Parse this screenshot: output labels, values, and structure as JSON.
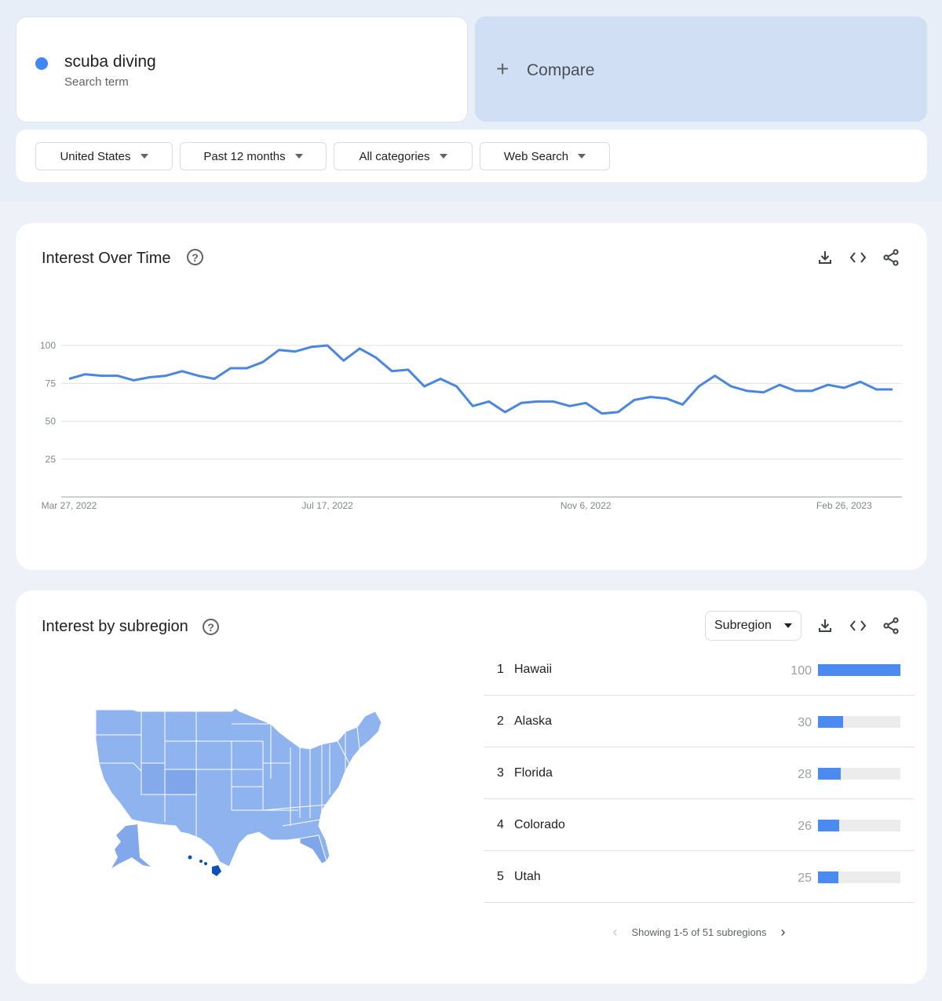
{
  "search_term": {
    "name": "scuba diving",
    "subtitle": "Search term",
    "color": "#4285f4"
  },
  "compare": {
    "icon": "plus-icon",
    "label": "Compare"
  },
  "filters": [
    {
      "label": "United States"
    },
    {
      "label": "Past 12 months"
    },
    {
      "label": "All categories"
    },
    {
      "label": "Web Search"
    }
  ],
  "interest_over_time": {
    "title": "Interest Over Time",
    "help_icon": "?",
    "tools": [
      "download-icon",
      "embed-code-icon",
      "share-icon"
    ]
  },
  "interest_by_subregion": {
    "title": "Interest by subregion",
    "help_icon": "?",
    "resolution_select": "Subregion",
    "tools": [
      "download-icon",
      "embed-code-icon",
      "share-icon"
    ],
    "rows": [
      {
        "rank": "1",
        "name": "Hawaii",
        "value": 100
      },
      {
        "rank": "2",
        "name": "Alaska",
        "value": 30
      },
      {
        "rank": "3",
        "name": "Florida",
        "value": 28
      },
      {
        "rank": "4",
        "name": "Colorado",
        "value": 26
      },
      {
        "rank": "5",
        "name": "Utah",
        "value": 25
      }
    ],
    "pager_text": "Showing 1-5 of 51 subregions",
    "map_highlight": "Hawaii",
    "map_colors": {
      "base": "#8fb3ee",
      "mid": "#7fa6ea",
      "high": "#0b53b8"
    }
  },
  "chart_data": {
    "type": "line",
    "title": "Interest Over Time",
    "xlabel": "",
    "ylabel": "",
    "ylim": [
      0,
      100
    ],
    "yticks": [
      25,
      50,
      75,
      100
    ],
    "xtick_labels": [
      "Mar 27, 2022",
      "Jul 17, 2022",
      "Nov 6, 2022",
      "Feb 26, 2023"
    ],
    "xtick_indices": [
      0,
      16,
      32,
      48
    ],
    "grid": true,
    "series": [
      {
        "name": "scuba diving",
        "color": "#4a86e0",
        "values": [
          78,
          81,
          80,
          80,
          77,
          79,
          80,
          83,
          80,
          78,
          85,
          85,
          89,
          97,
          96,
          99,
          100,
          90,
          98,
          92,
          83,
          84,
          73,
          78,
          73,
          60,
          63,
          56,
          62,
          63,
          63,
          60,
          62,
          55,
          56,
          64,
          66,
          65,
          61,
          73,
          80,
          73,
          70,
          69,
          74,
          70,
          70,
          74,
          72,
          76,
          71,
          71
        ]
      }
    ]
  }
}
